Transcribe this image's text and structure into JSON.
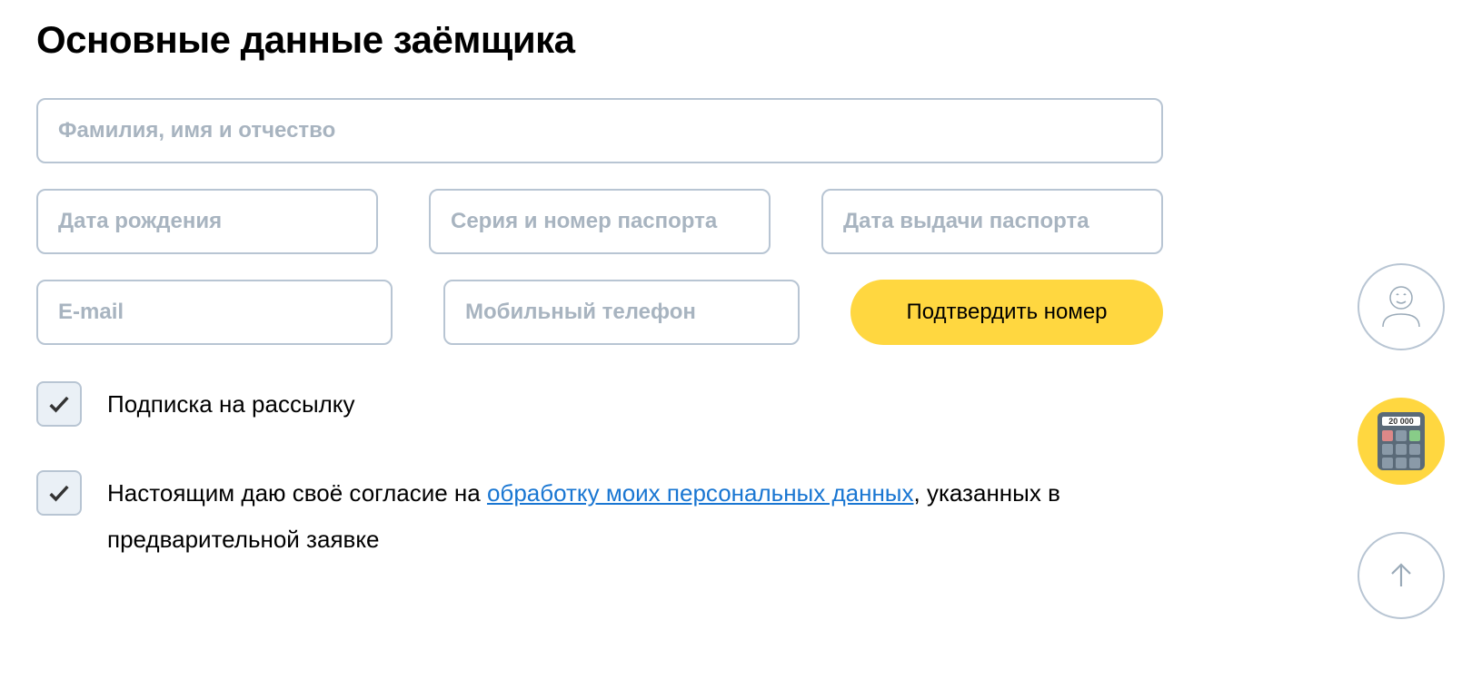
{
  "heading": "Основные данные заёмщика",
  "fields": {
    "full_name_placeholder": "Фамилия, имя и отчество",
    "birth_date_placeholder": "Дата рождения",
    "passport_number_placeholder": "Серия и номер паспорта",
    "passport_date_placeholder": "Дата выдачи паспорта",
    "email_placeholder": "E-mail",
    "phone_placeholder": "Мобильный телефон"
  },
  "buttons": {
    "confirm_number": "Подтвердить номер"
  },
  "checkboxes": {
    "newsletter_label": "Подписка на рассылку",
    "consent_prefix": "Настоящим даю своё согласие на ",
    "consent_link": "обработку моих персональных данных",
    "consent_suffix": ", указанных в предварительной заявке"
  },
  "calculator": {
    "display_value": "20 000"
  }
}
